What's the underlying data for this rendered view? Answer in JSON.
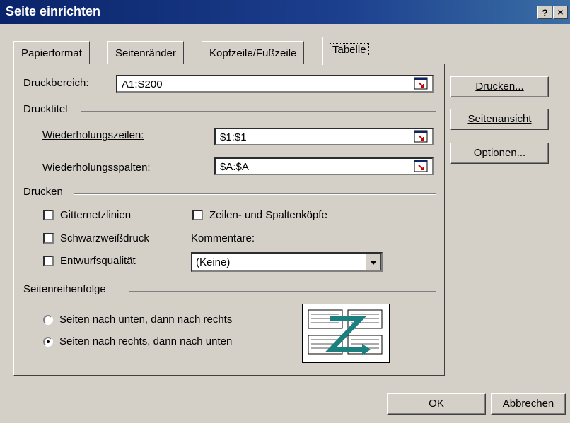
{
  "window": {
    "title": "Seite einrichten",
    "help": "?",
    "close": "×"
  },
  "tabs": [
    {
      "label": "Papierformat",
      "active": false
    },
    {
      "label": "Seitenränder",
      "active": false
    },
    {
      "label": "Kopfzeile/Fußzeile",
      "active": false
    },
    {
      "label": "Tabelle",
      "active": true
    }
  ],
  "print_area": {
    "label": "Druckbereich:",
    "value": "A1:S200"
  },
  "print_titles": {
    "section": "Drucktitel",
    "rows_label": "Wiederholungszeilen:",
    "rows_value": "$1:$1",
    "cols_label": "Wiederholungsspalten:",
    "cols_value": "$A:$A"
  },
  "print": {
    "section": "Drucken",
    "gridlines": "Gitternetzlinien",
    "black_white": "Schwarzweißdruck",
    "draft": "Entwurfsqualität",
    "headings": "Zeilen- und Spaltenköpfe",
    "comments_label": "Kommentare:",
    "comments_value": "(Keine)"
  },
  "page_order": {
    "section": "Seitenreihenfolge",
    "down_then_over": "Seiten nach unten, dann nach rechts",
    "over_then_down": "Seiten nach rechts, dann nach unten",
    "selected": "over_then_down"
  },
  "buttons": {
    "print": "Drucken...",
    "preview": "Seitenansicht",
    "options": "Optionen...",
    "ok": "OK",
    "cancel": "Abbrechen"
  },
  "colors": {
    "title_bar": "#0a246a",
    "dialog_face": "#d4d0c8",
    "diagram_arrow": "#1b7f7f"
  }
}
